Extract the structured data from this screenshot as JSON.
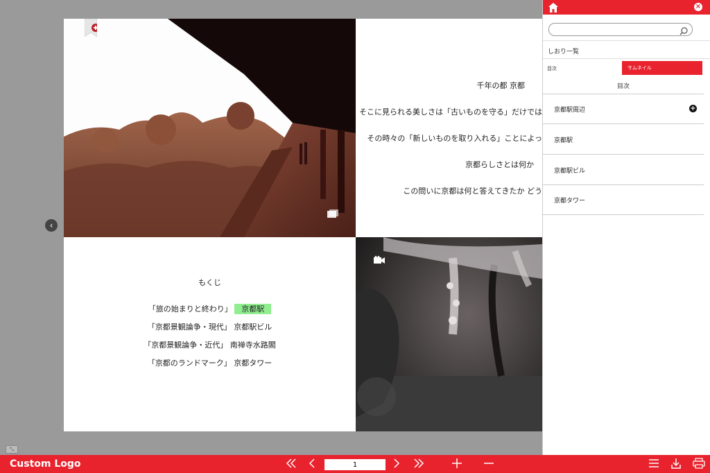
{
  "book": {
    "spread_text": {
      "title": "千年の都 京都",
      "lines": [
        "そこに見られる美しさは「古いものを守る」だけでは",
        "その時々の「新しいものを取り入れる」ことによっ",
        "京都らしさとは何か",
        "この問いに京都は何と答えてきたか どう"
      ]
    },
    "toc": {
      "title": "もくじ",
      "rows": [
        {
          "chapter": "「旅の始まりと終わり」",
          "link": "京都駅"
        },
        {
          "chapter": "「京都景観論争・現代」",
          "link": "京都駅ビル"
        },
        {
          "chapter": "「京都景観論争・近代」",
          "link": "南禅寺水路閣"
        },
        {
          "chapter": "「京都のランドマーク」",
          "link": "京都タワー"
        }
      ]
    }
  },
  "sidebar": {
    "search_placeholder": "",
    "bookmarks_label": "しおり一覧",
    "tab_toc": "目次",
    "tab_thumbnails": "サムネイル",
    "toc_heading": "目次",
    "items": [
      "京都駅周辺",
      "京都駅",
      "京都駅ビル",
      "京都タワー"
    ]
  },
  "toolbar": {
    "logo": "Custom Logo",
    "page_number": "1"
  },
  "icons": {
    "home": "home-icon",
    "close": "close-icon",
    "search": "search-icon",
    "first": "first-page-icon",
    "prev": "prev-page-icon",
    "next": "next-page-icon",
    "last": "last-page-icon",
    "zoom_in": "zoom-in-icon",
    "zoom_out": "zoom-out-icon",
    "menu": "menu-icon",
    "download": "download-icon",
    "print": "print-icon"
  },
  "colors": {
    "accent": "#e8232e",
    "highlight": "#90ee90"
  }
}
